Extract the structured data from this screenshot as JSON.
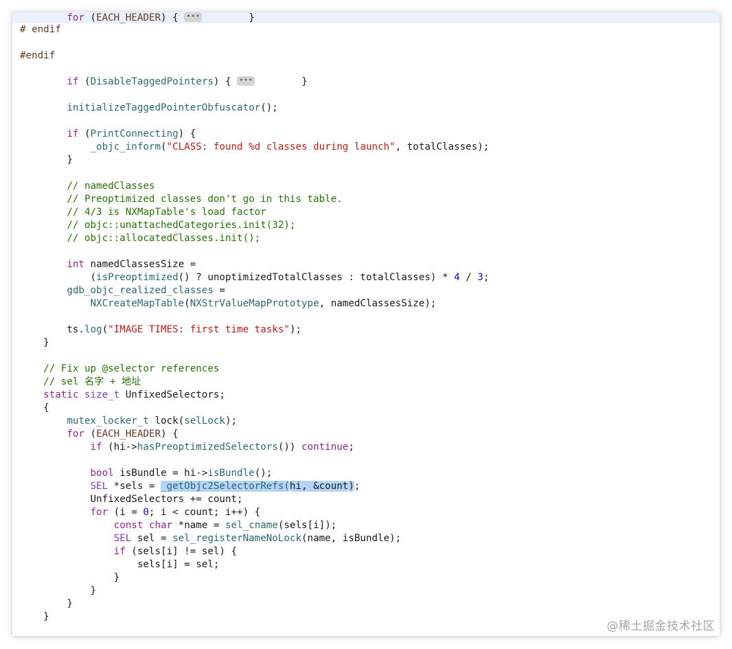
{
  "editor": {
    "lines": [
      {
        "highlight": true,
        "segs": [
          {
            "t": "        "
          },
          {
            "t": "for",
            "c": "kw"
          },
          {
            "t": " ("
          },
          {
            "t": "EACH_HEADER",
            "c": "pp"
          },
          {
            "t": ") { "
          },
          {
            "fold": "•••"
          },
          {
            "t": "        }"
          }
        ]
      },
      {
        "segs": [
          {
            "t": "# endif",
            "c": "pp"
          }
        ]
      },
      {
        "segs": []
      },
      {
        "segs": [
          {
            "t": "#endif",
            "c": "pp"
          }
        ]
      },
      {
        "segs": []
      },
      {
        "segs": [
          {
            "t": "        "
          },
          {
            "t": "if",
            "c": "kw"
          },
          {
            "t": " ("
          },
          {
            "t": "DisableTaggedPointers",
            "c": "fn"
          },
          {
            "t": ") { "
          },
          {
            "fold": "•••"
          },
          {
            "t": "        }"
          }
        ]
      },
      {
        "segs": []
      },
      {
        "segs": [
          {
            "t": "        "
          },
          {
            "t": "initializeTaggedPointerObfuscator",
            "c": "fn"
          },
          {
            "t": "();"
          }
        ]
      },
      {
        "segs": []
      },
      {
        "segs": [
          {
            "t": "        "
          },
          {
            "t": "if",
            "c": "kw"
          },
          {
            "t": " ("
          },
          {
            "t": "PrintConnecting",
            "c": "fn"
          },
          {
            "t": ") {"
          }
        ]
      },
      {
        "segs": [
          {
            "t": "            "
          },
          {
            "t": "_objc_inform",
            "c": "fn"
          },
          {
            "t": "("
          },
          {
            "t": "\"CLASS: found %d classes during launch\"",
            "c": "str"
          },
          {
            "t": ", totalClasses);"
          }
        ]
      },
      {
        "segs": [
          {
            "t": "        }"
          }
        ]
      },
      {
        "segs": []
      },
      {
        "segs": [
          {
            "t": "        "
          },
          {
            "t": "// namedClasses",
            "c": "cm"
          }
        ]
      },
      {
        "segs": [
          {
            "t": "        "
          },
          {
            "t": "// Preoptimized classes don't go in this table.",
            "c": "cm"
          }
        ]
      },
      {
        "segs": [
          {
            "t": "        "
          },
          {
            "t": "// 4/3 is NXMapTable's load factor",
            "c": "cm"
          }
        ]
      },
      {
        "segs": [
          {
            "t": "        "
          },
          {
            "t": "// objc::unattachedCategories.init(32);",
            "c": "cm"
          }
        ]
      },
      {
        "segs": [
          {
            "t": "        "
          },
          {
            "t": "// objc::allocatedClasses.init();",
            "c": "cm"
          }
        ]
      },
      {
        "segs": []
      },
      {
        "segs": [
          {
            "t": "        "
          },
          {
            "t": "int",
            "c": "kw"
          },
          {
            "t": " namedClassesSize ="
          }
        ]
      },
      {
        "segs": [
          {
            "t": "            ("
          },
          {
            "t": "isPreoptimized",
            "c": "fn"
          },
          {
            "t": "() ? unoptimizedTotalClasses : totalClasses) * "
          },
          {
            "t": "4",
            "c": "num"
          },
          {
            "t": " / "
          },
          {
            "t": "3",
            "c": "num"
          },
          {
            "t": ";"
          }
        ]
      },
      {
        "segs": [
          {
            "t": "        "
          },
          {
            "t": "gdb_objc_realized_classes",
            "c": "fn"
          },
          {
            "t": " ="
          }
        ]
      },
      {
        "segs": [
          {
            "t": "            "
          },
          {
            "t": "NXCreateMapTable",
            "c": "fn"
          },
          {
            "t": "("
          },
          {
            "t": "NXStrValueMapPrototype",
            "c": "fn"
          },
          {
            "t": ", namedClassesSize);"
          }
        ]
      },
      {
        "segs": []
      },
      {
        "segs": [
          {
            "t": "        ts."
          },
          {
            "t": "log",
            "c": "fn"
          },
          {
            "t": "("
          },
          {
            "t": "\"IMAGE TIMES: first time tasks\"",
            "c": "str"
          },
          {
            "t": ");"
          }
        ]
      },
      {
        "segs": [
          {
            "t": "    }"
          }
        ]
      },
      {
        "segs": []
      },
      {
        "segs": [
          {
            "t": "    "
          },
          {
            "t": "// Fix up @selector references",
            "c": "cm"
          }
        ]
      },
      {
        "segs": [
          {
            "t": "    "
          },
          {
            "t": "// sel 名字 + 地址",
            "c": "cm"
          }
        ]
      },
      {
        "segs": [
          {
            "t": "    "
          },
          {
            "t": "static",
            "c": "kw"
          },
          {
            "t": " "
          },
          {
            "t": "size_t",
            "c": "ty"
          },
          {
            "t": " UnfixedSelectors;"
          }
        ]
      },
      {
        "segs": [
          {
            "t": "    {"
          }
        ]
      },
      {
        "segs": [
          {
            "t": "        "
          },
          {
            "t": "mutex_locker_t",
            "c": "fn"
          },
          {
            "t": " lock("
          },
          {
            "t": "selLock",
            "c": "fn"
          },
          {
            "t": ");"
          }
        ]
      },
      {
        "segs": [
          {
            "t": "        "
          },
          {
            "t": "for",
            "c": "kw"
          },
          {
            "t": " ("
          },
          {
            "t": "EACH_HEADER",
            "c": "pp"
          },
          {
            "t": ") {"
          }
        ]
      },
      {
        "segs": [
          {
            "t": "            "
          },
          {
            "t": "if",
            "c": "kw"
          },
          {
            "t": " (hi->"
          },
          {
            "t": "hasPreoptimizedSelectors",
            "c": "fn"
          },
          {
            "t": "()) "
          },
          {
            "t": "continue",
            "c": "kw"
          },
          {
            "t": ";"
          }
        ]
      },
      {
        "segs": []
      },
      {
        "segs": [
          {
            "t": "            "
          },
          {
            "t": "bool",
            "c": "kw"
          },
          {
            "t": " isBundle = hi->"
          },
          {
            "t": "isBundle",
            "c": "fn"
          },
          {
            "t": "();"
          }
        ]
      },
      {
        "segs": [
          {
            "t": "            "
          },
          {
            "t": "SEL",
            "c": "ty"
          },
          {
            "t": " *sels = "
          },
          {
            "t": "_getObjc2SelectorRefs(",
            "c": "fn",
            "sel": true
          },
          {
            "t": "hi, &count",
            "sel": true
          },
          {
            "t": ")",
            "sel": true
          },
          {
            "t": ";"
          }
        ]
      },
      {
        "segs": [
          {
            "t": "            UnfixedSelectors += count;"
          }
        ]
      },
      {
        "segs": [
          {
            "t": "            "
          },
          {
            "t": "for",
            "c": "kw"
          },
          {
            "t": " (i = "
          },
          {
            "t": "0",
            "c": "num"
          },
          {
            "t": "; i < count; i++) {"
          }
        ]
      },
      {
        "segs": [
          {
            "t": "                "
          },
          {
            "t": "const",
            "c": "kw"
          },
          {
            "t": " "
          },
          {
            "t": "char",
            "c": "kw"
          },
          {
            "t": " *name = "
          },
          {
            "t": "sel_cname",
            "c": "fn"
          },
          {
            "t": "(sels[i]);"
          }
        ]
      },
      {
        "segs": [
          {
            "t": "                "
          },
          {
            "t": "SEL",
            "c": "ty"
          },
          {
            "t": " sel = "
          },
          {
            "t": "sel_registerNameNoLock",
            "c": "fn"
          },
          {
            "t": "(name, isBundle);"
          }
        ]
      },
      {
        "segs": [
          {
            "t": "                "
          },
          {
            "t": "if",
            "c": "kw"
          },
          {
            "t": " (sels[i] != sel) {"
          }
        ]
      },
      {
        "segs": [
          {
            "t": "                    sels[i] = sel;"
          }
        ]
      },
      {
        "segs": [
          {
            "t": "                }"
          }
        ]
      },
      {
        "segs": [
          {
            "t": "            }"
          }
        ]
      },
      {
        "segs": [
          {
            "t": "        }"
          }
        ]
      },
      {
        "segs": [
          {
            "t": "    }"
          }
        ]
      }
    ]
  },
  "watermark": "@稀土掘金技术社区",
  "colors": {
    "keyword": "#9b2393",
    "preprocessor": "#643820",
    "function": "#2b6a72",
    "type": "#7a3ec1",
    "string": "#c41a16",
    "comment": "#267507",
    "number": "#1c00cf",
    "selection": "#b5d3f6",
    "current_line": "#e9f1fe"
  }
}
